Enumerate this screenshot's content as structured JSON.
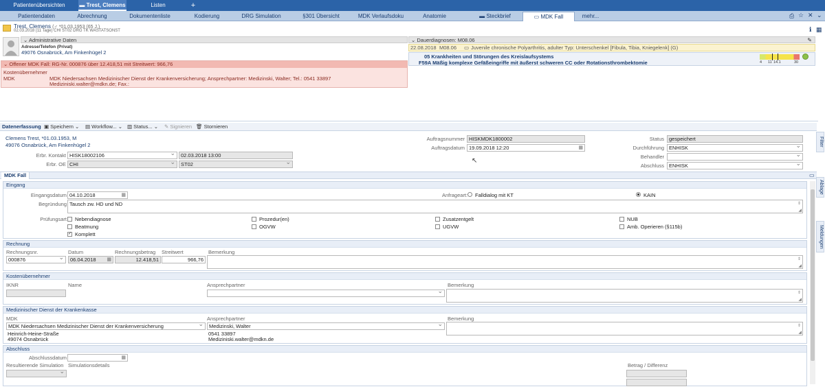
{
  "topbar": {
    "tabs": [
      "Patientenübersichten",
      "Trest, Clemens",
      "Listen",
      "+"
    ]
  },
  "nav": {
    "tabs": [
      "Patientendaten",
      "Abrechnung",
      "Dokumentenliste",
      "Kodierung",
      "DRG Simulation",
      "§301 Übersicht",
      "MDK Verlaufsdoku",
      "Anatomie",
      "Steckbrief",
      "MDK Fall",
      "mehr..."
    ]
  },
  "patient": {
    "name": "Trest, Clemens",
    "gender_dob": "(♂ *01.03.1953 (65 J.)",
    "line2": "02.03.2018 (11 Tage)  CHI ST02  DRG TK  WASTATSONST",
    "admin_header": "Administrative Daten",
    "address_label": "Adresse/Telefon (Privat)",
    "address": "49076 Osnabrück, Am Finkenhügel 2",
    "mdk_header": "Offener MDK Fall: RG-Nr. 000876 über 12.418,51 mit Streitwert: 966,76",
    "kosten_label": "Kostenübernehmer",
    "kosten_key": "MDK",
    "kosten_line1": "MDK Niedersachsen Medizinischer Dienst der Krankenversicherung; Ansprechpartner: Medizinski, Walter; Tel.: 0541 33897",
    "kosten_line2": "Mediziniski.walter@mdkn.de; Fax.:"
  },
  "diag": {
    "header": "Dauerdiagnosen: M08.06",
    "date": "22.08.2018",
    "code": "M08.06",
    "text": "Juvenile chronische Polyarthritis, adulter Typ: Unterschenkel [Fibula, Tibia, Kniegelenk] (G)",
    "mdc": "05 Krankheiten und Störungen des Kreislaufsystems",
    "drg": "F59A Mäßig komplexe Gefäßeingriffe mit äußerst schweren CC oder Rotationsthrombektomie",
    "scale": [
      "4",
      "11",
      "14.1",
      "30"
    ]
  },
  "toolbar": {
    "items": [
      "Datenerfassung",
      "Speichern",
      "Workflow...",
      "Status...",
      "Signieren",
      "Stornieren"
    ]
  },
  "form": {
    "patient_line1": "Clemens Trest, *01.03.1953, M",
    "patient_line2": "49076 Osnabrück, Am Finkenhügel 2",
    "erbr_kontakt_label": "Erbr. Kontakt",
    "erbr_kontakt": "HISK18002106",
    "erbr_kontakt_date": "02.03.2018 13:00",
    "erbr_oe_label": "Erbr. OE",
    "erbr_oe": "CHI",
    "erbr_oe2": "ST02",
    "auftragsnummer_label": "Auftragsnummer",
    "auftragsnummer": "HISKMDK1800002",
    "auftragsdatum_label": "Auftragsdatum",
    "auftragsdatum": "19.09.2018 12:20",
    "status_label": "Status",
    "status": "gespeichert",
    "durchfuehrung_label": "Durchführung",
    "durchfuehrung": "ENHISK",
    "behandler_label": "Behandler",
    "behandler": "",
    "abschluss_label": "Abschluss",
    "abschluss": "ENHISK"
  },
  "mdkfall": {
    "tab": "MDK Fall"
  },
  "eingang": {
    "title": "Eingang",
    "datum_label": "Eingangsdatum",
    "datum": "04.10.2018",
    "anfrageart_label": "Anfrageart:",
    "opt1": "Falldialog mit KT",
    "opt2": "KAIN",
    "begr_label": "Begründung",
    "begr": "Tausch zw. HD und ND",
    "pruef_label": "Prüfungsart",
    "checks": [
      "Nebendiagnose",
      "Beatmung",
      "Komplett",
      "Prozedur(en)",
      "OGVW",
      "Zusatzentgelt",
      "UGVW",
      "NUB",
      "Amb. Operieren (§115b)"
    ]
  },
  "rechnung": {
    "title": "Rechnung",
    "nr_label": "Rechnungsnr.",
    "nr": "000876",
    "datum_label": "Datum",
    "datum": "06.04.2018",
    "betrag_label": "Rechnungsbetrag",
    "betrag": "12.418,51",
    "streit_label": "Streitwert",
    "streit": "966,76",
    "bem_label": "Bemerkung"
  },
  "kosten": {
    "title": "Kostenübernehmer",
    "ikn_label": "IKNR",
    "name_label": "Name",
    "ansp_label": "Ansprechpartner",
    "bem_label": "Bemerkung"
  },
  "mdkdienst": {
    "title": "Medizinischer Dienst der Krankenkasse",
    "mdk_label": "MDK",
    "mdk": "MDK Niedersachsen Medizinischer Dienst der Krankenversicherung",
    "addr1": "Heinrich-Heine-Straße",
    "addr2": "49074 Osnabrück",
    "ansp_label": "Ansprechpartner",
    "ansp": "Medizinski, Walter",
    "tel": "0541 33897",
    "mail": "Mediziniski.walter@mdkn.de",
    "bem_label": "Bemerkung"
  },
  "abschluss": {
    "title": "Abschluss",
    "datum_label": "Abschlussdatum",
    "sim_label": "Resultierende Simulation",
    "details_label": "Simulationsdetails",
    "betrag_label": "Betrag / Differenz"
  },
  "side": {
    "filter": "Filter",
    "ablage": "Ablage",
    "meldungen": "Meldungen"
  }
}
